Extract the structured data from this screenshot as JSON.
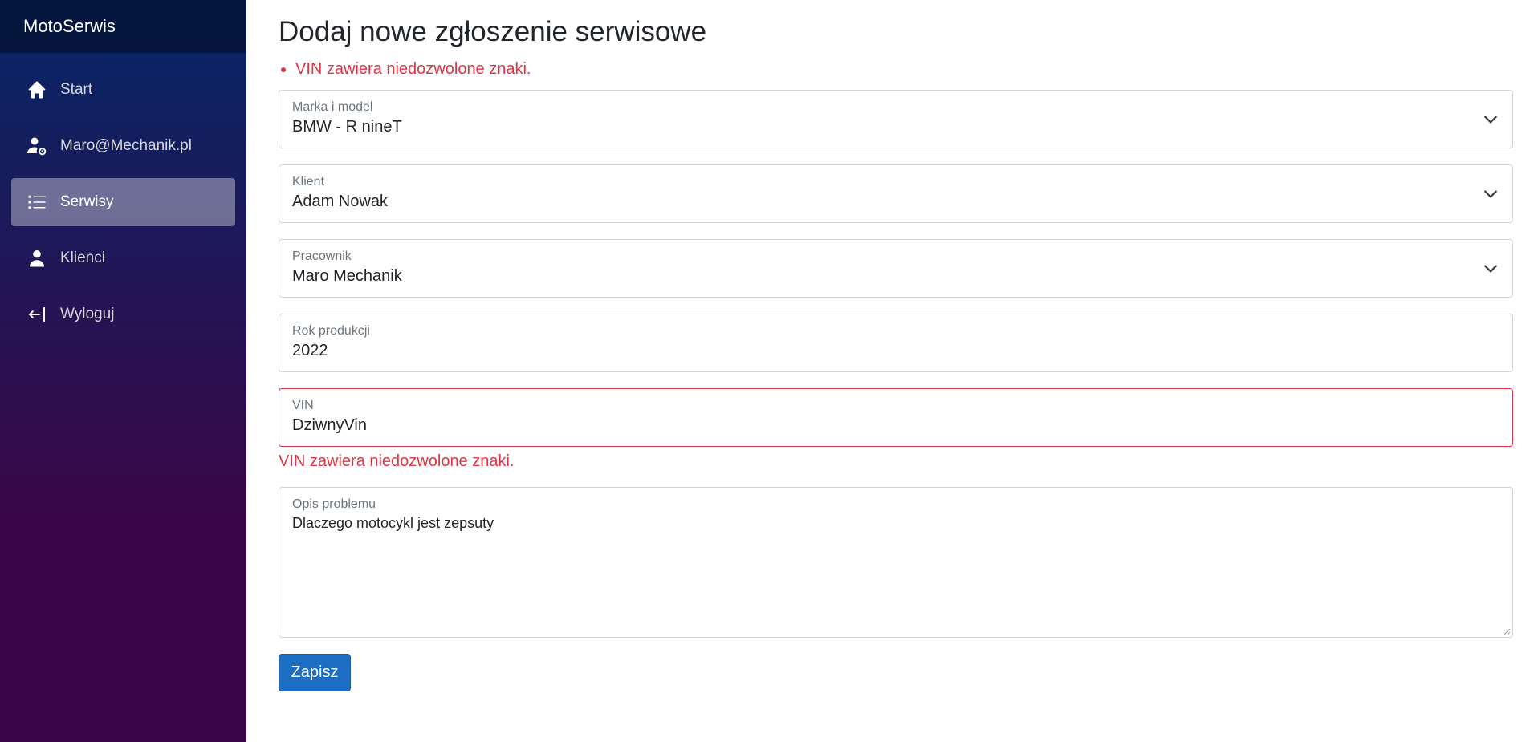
{
  "app": {
    "brand": "MotoSerwis"
  },
  "sidebar": {
    "items": [
      {
        "label": "Start",
        "icon": "home-icon",
        "active": false
      },
      {
        "label": "Maro@Mechanik.pl",
        "icon": "user-gear-icon",
        "active": false
      },
      {
        "label": "Serwisy",
        "icon": "list-icon",
        "active": true
      },
      {
        "label": "Klienci",
        "icon": "person-icon",
        "active": false
      },
      {
        "label": "Wyloguj",
        "icon": "logout-icon",
        "active": false
      }
    ]
  },
  "main": {
    "title": "Dodaj nowe zgłoszenie serwisowe",
    "validation_summary": [
      "VIN zawiera niedozwolone znaki."
    ],
    "fields": {
      "model": {
        "label": "Marka i model",
        "value": "BMW - R nineT"
      },
      "client": {
        "label": "Klient",
        "value": "Adam Nowak"
      },
      "employee": {
        "label": "Pracownik",
        "value": "Maro Mechanik"
      },
      "year": {
        "label": "Rok produkcji",
        "value": "2022"
      },
      "vin": {
        "label": "VIN",
        "value": "DziwnyVin",
        "error": "VIN zawiera niedozwolone znaki."
      },
      "description": {
        "label": "Opis problemu",
        "value": "Dlaczego motocykl jest zepsuty"
      }
    },
    "save_label": "Zapisz"
  },
  "colors": {
    "error": "#dc3545",
    "primary": "#1b6ec2",
    "sidebar_top": "#052767",
    "sidebar_bottom": "#3a0647"
  }
}
